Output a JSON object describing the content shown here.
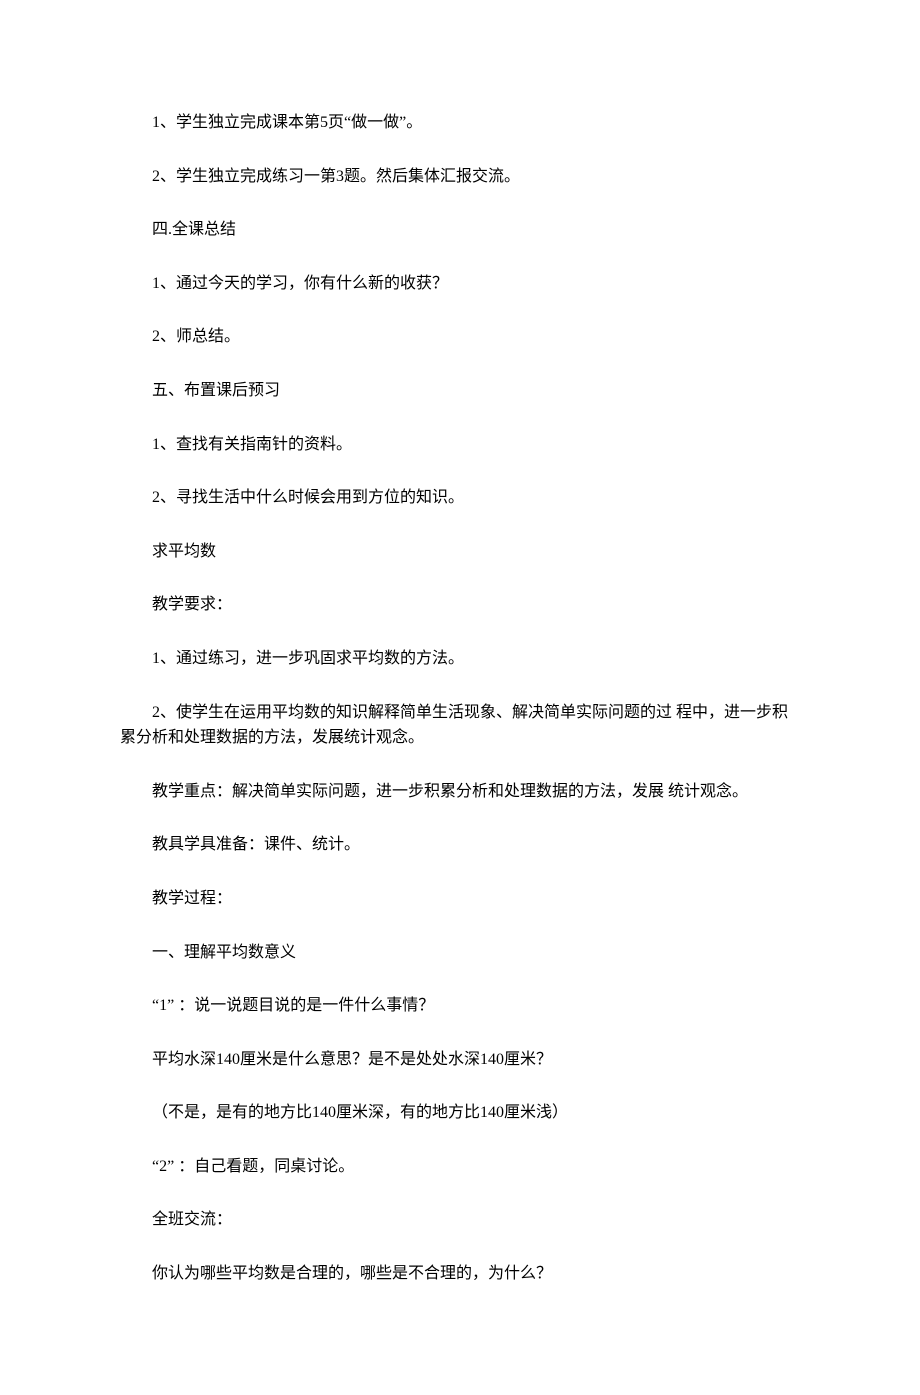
{
  "paragraphs": [
    {
      "text": "1、学生独立完成课本第5页“做一做”。",
      "indent": true
    },
    {
      "text": "2、学生独立完成练习一第3题。然后集体汇报交流。",
      "indent": true
    },
    {
      "text": "四.全课总结",
      "indent": true
    },
    {
      "text": "1、通过今天的学习，你有什么新的收获？",
      "indent": true
    },
    {
      "text": "2、师总结。",
      "indent": true
    },
    {
      "text": "五、布置课后预习",
      "indent": true
    },
    {
      "text": "1、查找有关指南针的资料。",
      "indent": true
    },
    {
      "text": "2、寻找生活中什么时候会用到方位的知识。",
      "indent": true
    },
    {
      "text": "求平均数",
      "indent": true
    },
    {
      "text": "教学要求：",
      "indent": true
    },
    {
      "text": "1、通过练习，进一步巩固求平均数的方法。",
      "indent": true
    },
    {
      "text": "2、使学生在运用平均数的知识解释简单生活现象、解决简单实际问题的过 程中，进一步积累分析和处理数据的方法，发展统计观念。",
      "indent": true
    },
    {
      "text": "教学重点：解决简单实际问题，进一步积累分析和处理数据的方法，发展 统计观念。",
      "indent": true
    },
    {
      "text": "教具学具准备：课件、统计。",
      "indent": true
    },
    {
      "text": "教学过程：",
      "indent": true
    },
    {
      "text": "一、理解平均数意义",
      "indent": true
    },
    {
      "text": "“1” ：说一说题目说的是一件什么事情？",
      "indent": true
    },
    {
      "text": "平均水深140厘米是什么意思？是不是处处水深140厘米？",
      "indent": true
    },
    {
      "text": "（不是，是有的地方比140厘米深，有的地方比140厘米浅）",
      "indent": true
    },
    {
      "text": "“2” ：自己看题，同桌讨论。",
      "indent": true
    },
    {
      "text": "全班交流：",
      "indent": true
    },
    {
      "text": "你认为哪些平均数是合理的，哪些是不合理的，为什么？",
      "indent": true
    }
  ]
}
